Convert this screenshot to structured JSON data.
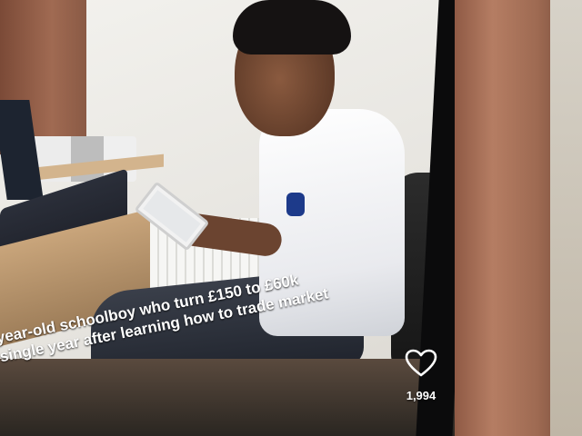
{
  "post": {
    "caption_line1": "year-old schoolboy who turn £150 to £60k",
    "caption_line2": "single year after learning how to trade market",
    "like_icon": "heart-icon",
    "like_count": "1,994"
  }
}
